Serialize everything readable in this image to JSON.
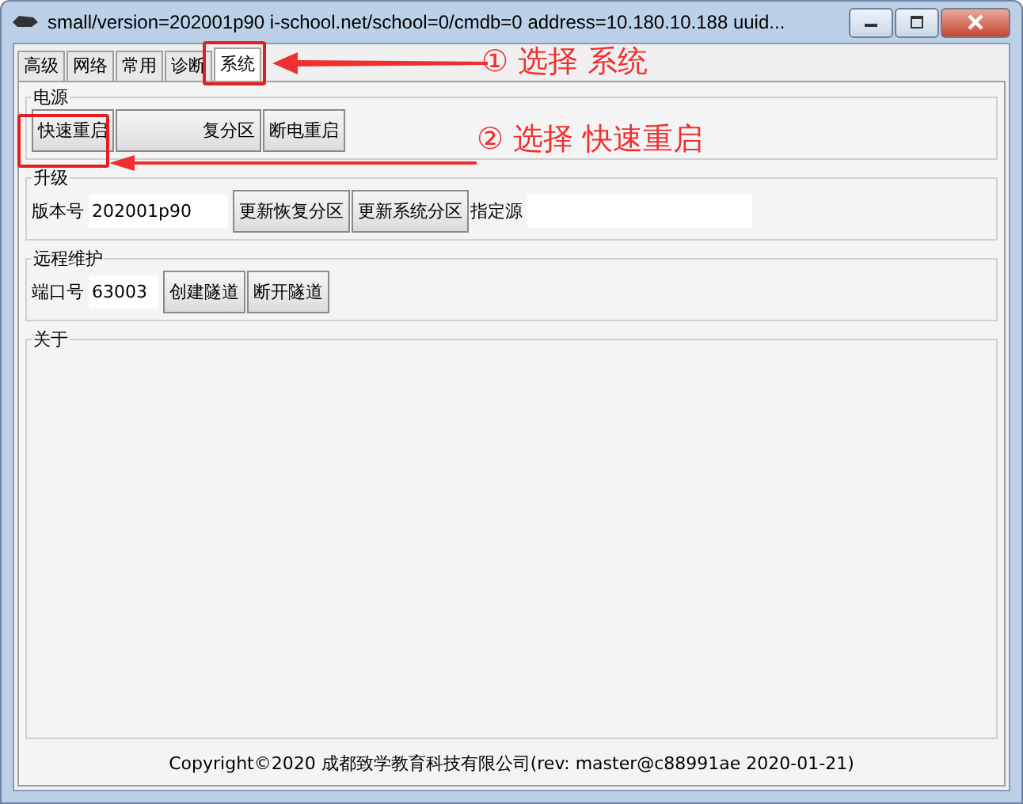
{
  "window": {
    "title": "small/version=202001p90 i-school.net/school=0/cmdb=0 address=10.180.10.188 uuid..."
  },
  "tabs": [
    {
      "label": "高级",
      "selected": false
    },
    {
      "label": "网络",
      "selected": false
    },
    {
      "label": "常用",
      "selected": false
    },
    {
      "label": "诊断",
      "selected": false
    },
    {
      "label": "系统",
      "selected": true
    }
  ],
  "power": {
    "title": "电源",
    "buttons": [
      "快速重启",
      "复分区",
      "断电重启"
    ]
  },
  "upgrade": {
    "title": "升级",
    "version_label": "版本号",
    "version_value": "202001p90",
    "buttons": [
      "更新恢复分区",
      "更新系统分区"
    ],
    "source_label": "指定源"
  },
  "remote": {
    "title": "远程维护",
    "port_label": "端口号",
    "port_value": "63003",
    "buttons": [
      "创建隧道",
      "断开隧道"
    ]
  },
  "about": {
    "title": "关于"
  },
  "footer": "Copyright©2020 成都致学教育科技有限公司(rev: master@c88991ae 2020-01-21)",
  "annotations": [
    {
      "label": "① 选择 系统"
    },
    {
      "label": "② 选择 快速重启"
    }
  ]
}
